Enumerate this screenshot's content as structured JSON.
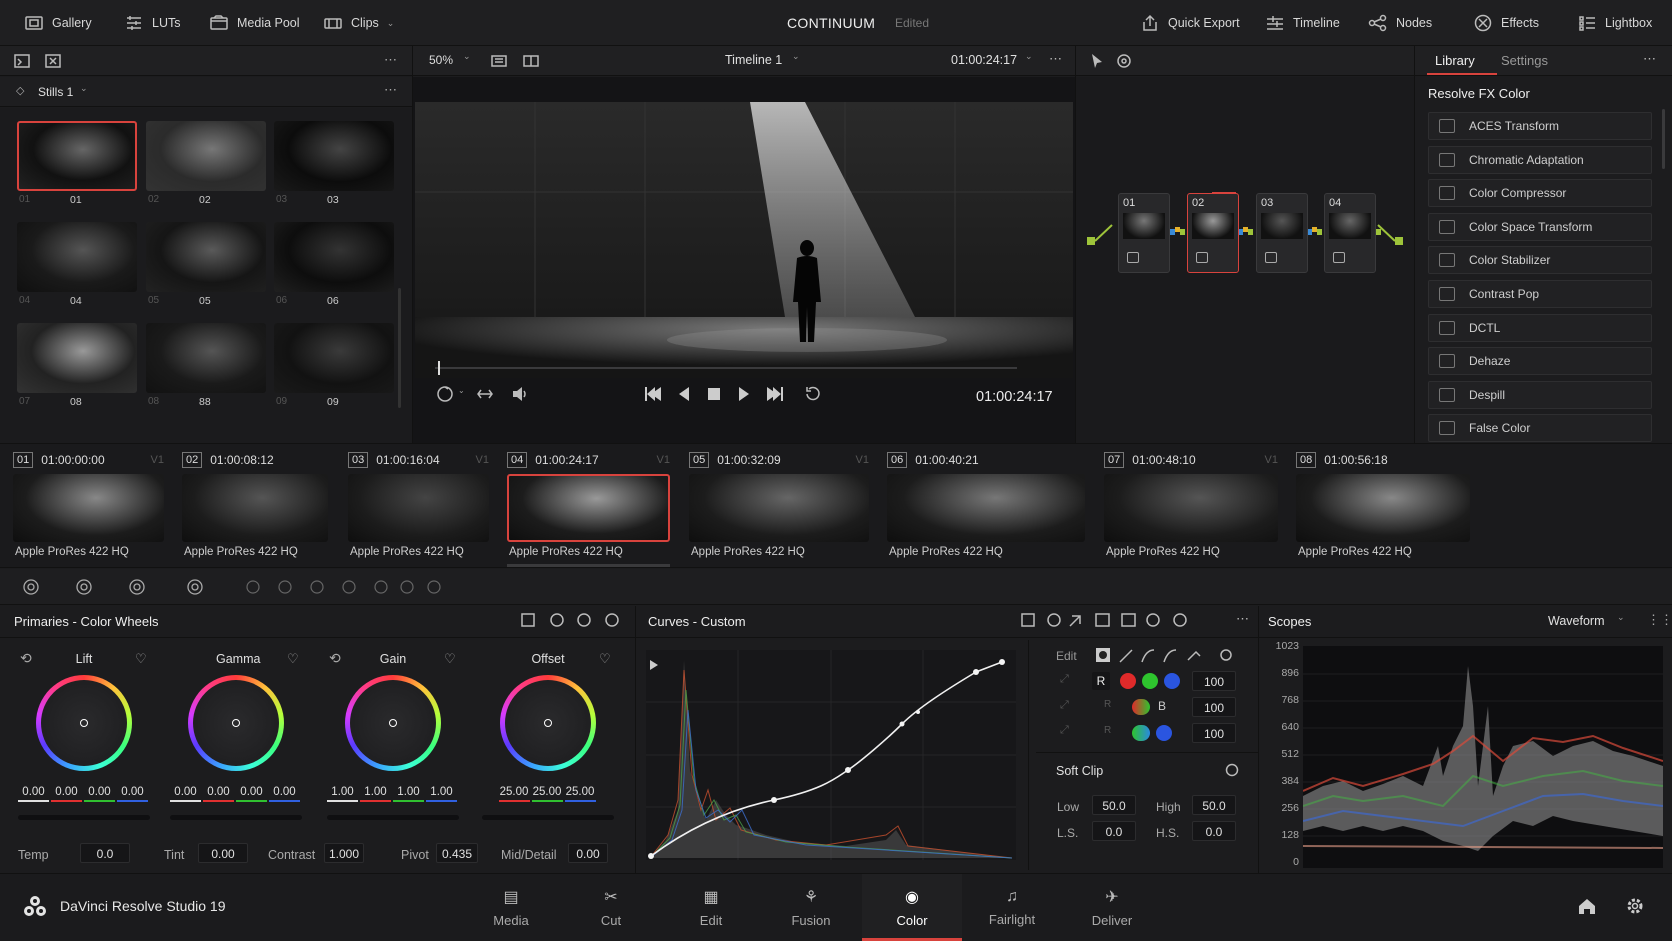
{
  "topbar": {
    "gallery": "Gallery",
    "luts": "LUTs",
    "media_pool": "Media Pool",
    "clips": "Clips",
    "project": "CONTINUUM",
    "status": "Edited",
    "quick_export": "Quick Export",
    "timeline": "Timeline",
    "nodes": "Nodes",
    "effects": "Effects",
    "lightbox": "Lightbox"
  },
  "gallery": {
    "album": "Stills 1",
    "stills": [
      {
        "a": "01",
        "b": "01"
      },
      {
        "a": "02",
        "b": "02"
      },
      {
        "a": "03",
        "b": "03"
      },
      {
        "a": "04",
        "b": "04"
      },
      {
        "a": "05",
        "b": "05"
      },
      {
        "a": "06",
        "b": "06"
      },
      {
        "a": "07",
        "b": "08"
      },
      {
        "a": "08",
        "b": "88"
      },
      {
        "a": "09",
        "b": "09"
      }
    ]
  },
  "viewer": {
    "zoom": "50%",
    "timeline_name": "Timeline 1",
    "timecode_top": "01:00:24:17",
    "timecode": "01:00:24:17",
    "playhead_progress": 0.05
  },
  "nodes": [
    {
      "label": "01"
    },
    {
      "label": "02"
    },
    {
      "label": "03"
    },
    {
      "label": "04"
    }
  ],
  "library": {
    "tab_library": "Library",
    "tab_settings": "Settings",
    "category": "Resolve FX Color",
    "items": [
      "ACES Transform",
      "Chromatic Adaptation",
      "Color Compressor",
      "Color Space Transform",
      "Color Stabilizer",
      "Contrast Pop",
      "DCTL",
      "Dehaze",
      "Despill",
      "False Color"
    ]
  },
  "clips": [
    {
      "num": "01",
      "tc": "01:00:00:00",
      "track": "V1",
      "codec": "Apple ProRes 422 HQ"
    },
    {
      "num": "02",
      "tc": "01:00:08:12",
      "track": "",
      "codec": "Apple ProRes 422 HQ"
    },
    {
      "num": "03",
      "tc": "01:00:16:04",
      "track": "V1",
      "codec": "Apple ProRes 422 HQ"
    },
    {
      "num": "04",
      "tc": "01:00:24:17",
      "track": "V1",
      "codec": "Apple ProRes 422 HQ"
    },
    {
      "num": "05",
      "tc": "01:00:32:09",
      "track": "V1",
      "codec": "Apple ProRes 422 HQ"
    },
    {
      "num": "06",
      "tc": "01:00:40:21",
      "track": "",
      "codec": "Apple ProRes 422 HQ"
    },
    {
      "num": "07",
      "tc": "01:00:48:10",
      "track": "V1",
      "codec": "Apple ProRes 422 HQ"
    },
    {
      "num": "08",
      "tc": "01:00:56:18",
      "track": "",
      "codec": "Apple ProRes 422 HQ"
    }
  ],
  "primaries": {
    "title": "Primaries - Color Wheels",
    "wheels": [
      {
        "label": "Lift",
        "values": [
          "0.00",
          "0.00",
          "0.00",
          "0.00"
        ]
      },
      {
        "label": "Gamma",
        "values": [
          "0.00",
          "0.00",
          "0.00",
          "0.00"
        ]
      },
      {
        "label": "Gain",
        "values": [
          "1.00",
          "1.00",
          "1.00",
          "1.00"
        ]
      },
      {
        "label": "Offset",
        "values": [
          "25.00",
          "25.00",
          "25.00"
        ]
      }
    ],
    "temp_label": "Temp",
    "temp": "0.0",
    "tint_label": "Tint",
    "tint": "0.00",
    "contrast_label": "Contrast",
    "contrast": "1.000",
    "pivot_label": "Pivot",
    "pivot": "0.435",
    "middetail_label": "Mid/Detail",
    "middetail": "0.00"
  },
  "curves": {
    "title": "Curves - Custom",
    "edit": "Edit",
    "r": "R",
    "b": "B",
    "v1": "100",
    "v2": "100",
    "v3": "100",
    "softclip": "Soft Clip",
    "low_label": "Low",
    "low": "50.0",
    "high_label": "High",
    "high": "50.0",
    "ls_label": "L.S.",
    "ls": "0.0",
    "hs_label": "H.S.",
    "hs": "0.0",
    "small_r1": "R",
    "small_r2": "R"
  },
  "scopes": {
    "title": "Scopes",
    "mode": "Waveform",
    "ticks": [
      "1023",
      "896",
      "768",
      "640",
      "512",
      "384",
      "256",
      "128",
      "0"
    ]
  },
  "bottomnav": {
    "app": "DaVinci Resolve Studio 19",
    "pages": [
      "Media",
      "Cut",
      "Edit",
      "Fusion",
      "Color",
      "Fairlight",
      "Deliver"
    ],
    "active": "Color"
  }
}
